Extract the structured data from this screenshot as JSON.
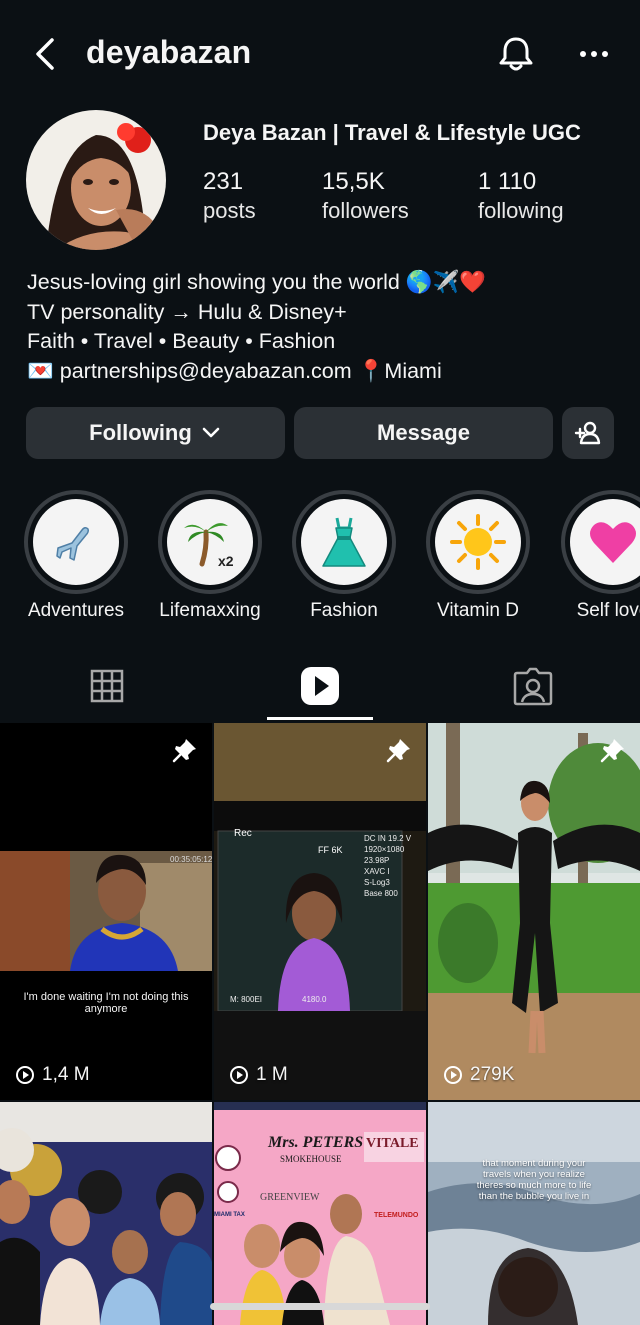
{
  "header": {
    "username": "deyabazan"
  },
  "profile": {
    "display_name": "Deya Bazan | Travel & Lifestyle UGC",
    "stats": [
      {
        "value": "231",
        "label": "posts"
      },
      {
        "value": "15,5K",
        "label": "followers"
      },
      {
        "value": "1 110",
        "label": "following"
      }
    ],
    "bio": [
      "Jesus-loving girl showing you the world 🌎✈️❤️",
      "TV personality → Hulu & Disney+",
      "Faith • Travel • Beauty • Fashion",
      "💌 partnerships@deyabazan.com 📍Miami"
    ]
  },
  "actions": {
    "following_label": "Following",
    "message_label": "Message"
  },
  "highlights": [
    {
      "label": "Adventures",
      "emoji": "✈️"
    },
    {
      "label": "Lifemaxxing",
      "emoji": "🌴",
      "suffix": "x2"
    },
    {
      "label": "Fashion",
      "emoji": "👗"
    },
    {
      "label": "Vitamin D",
      "emoji": "☀️"
    },
    {
      "label": "Self love",
      "emoji": "💗"
    }
  ],
  "tabs": [
    "grid-tab",
    "reels-tab",
    "tagged-tab"
  ],
  "reels": [
    {
      "views": "1,4 M",
      "pinned": true,
      "caption": "I'm done waiting I'm not doing this anymore"
    },
    {
      "views": "1 M",
      "pinned": true,
      "overlay_rec": "Rec",
      "overlay_specs": [
        "DC IN 19.2 V",
        "1920×1080",
        "23.98P",
        "XAVC I",
        "S-Log3",
        "Base 800"
      ],
      "overlay_ff": "FF 6K",
      "overlay_bottom": [
        "M: 800EI",
        "4180.0"
      ]
    },
    {
      "views": "279K",
      "pinned": true
    },
    {
      "views": ""
    },
    {
      "views": "",
      "signs": [
        "Mrs. PETERS",
        "SMOKEHOUSE",
        "VITALE",
        "GREENVIEW",
        "MIAMI TAX",
        "TELEMUNDO"
      ]
    },
    {
      "views": "",
      "caption": "that moment during your travels when you realize theres so much more to life than the bubble you live in"
    }
  ],
  "colors": {
    "background": "#0b1014",
    "button": "#2b3035",
    "text": "#f5f5f5"
  }
}
